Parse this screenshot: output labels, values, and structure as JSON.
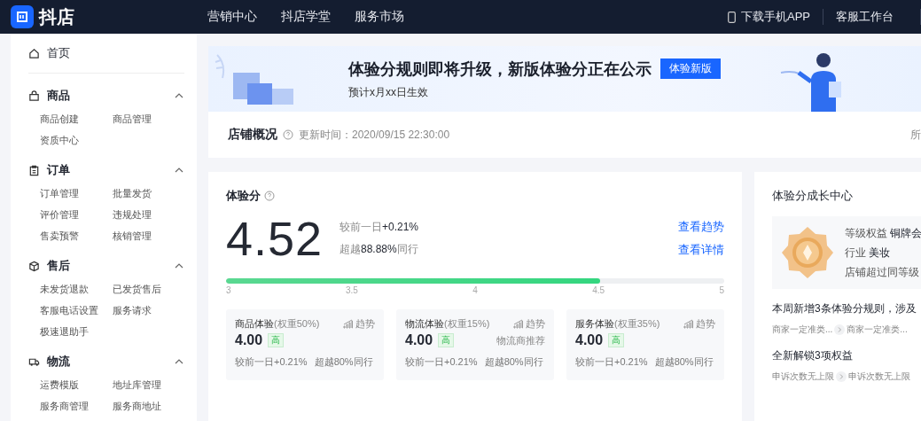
{
  "topbar": {
    "logo_text": "抖店",
    "nav": [
      {
        "label": "营销中心"
      },
      {
        "label": "抖店学堂"
      },
      {
        "label": "服务市场"
      }
    ],
    "actions": [
      {
        "label": "下载手机APP",
        "kind": "phone"
      },
      {
        "label": "客服工作台",
        "kind": "plain"
      }
    ]
  },
  "sidebar": {
    "home": "首页",
    "sections": [
      {
        "title": "商品",
        "kind": "bag",
        "expanded": true,
        "items": [
          "商品创建",
          "商品管理",
          "资质中心"
        ]
      },
      {
        "title": "订单",
        "kind": "clipboard",
        "expanded": true,
        "items": [
          "订单管理",
          "批量发货",
          "评价管理",
          "违规处理",
          "售卖预警",
          "核销管理"
        ]
      },
      {
        "title": "售后",
        "kind": "cube",
        "expanded": true,
        "items": [
          "未发货退款",
          "已发货售后",
          "客服电话设置",
          "服务请求",
          "极速退助手"
        ]
      },
      {
        "title": "物流",
        "kind": "truck",
        "expanded": true,
        "items": [
          "运费模版",
          "地址库管理",
          "服务商管理",
          "服务商地址"
        ]
      }
    ]
  },
  "banner": {
    "title": "体验分规则即将升级，新版体验分正在公示",
    "button": "体验新版",
    "subtitle": "预计x月xx日生效"
  },
  "overview": {
    "title": "店铺概况",
    "updated": "更新时间：2020/09/15 22:30:00",
    "column_2": "所"
  },
  "score_card": {
    "title": "体验分",
    "score": "4.52",
    "compare": "较前一日**+0.21%**",
    "beat": "超越**88.88%**同行",
    "links": [
      "查看趋势",
      "查看详情"
    ],
    "level": 0.75,
    "ticks": [
      "3",
      "3.5",
      "4",
      "4.5",
      "5"
    ],
    "sub_scores": [
      {
        "name": "商品体验",
        "weight": "(权重50%)",
        "trend": "趋势",
        "score": "4.00",
        "badge": "高",
        "compare": "较前一日+0.21%",
        "beat": "超越80%同行"
      },
      {
        "name": "物流体验",
        "weight": "(权重15%)",
        "trend": "趋势",
        "score": "4.00",
        "badge": "高",
        "note": "物流商推荐",
        "compare": "较前一日+0.21%",
        "beat": "超越80%同行"
      },
      {
        "name": "服务体验",
        "weight": "(权重35%)",
        "trend": "趋势",
        "score": "4.00",
        "badge": "高",
        "compare": "较前一日+0.21%",
        "beat": "超越80%同行"
      }
    ]
  },
  "growth": {
    "title": "体验分成长中心",
    "medal_lines": [
      "等级权益 **铜牌会**",
      "行业 **美妆**",
      "店铺超过同等级"
    ],
    "sections": [
      {
        "title": "本周新增3条体验分规则，涉及",
        "chips": [
          "商家一定准类...",
          "商家一定准类..."
        ]
      },
      {
        "title": "全新解锁3项权益",
        "chips": [
          "申诉次数无上限",
          "申诉次数无上限"
        ]
      }
    ]
  }
}
